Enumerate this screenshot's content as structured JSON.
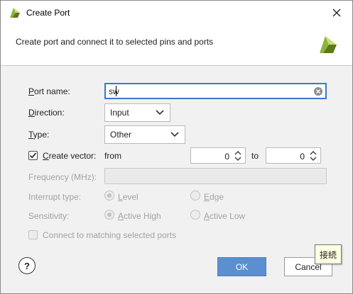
{
  "window": {
    "title": "Create Port",
    "close_icon": "close-icon",
    "logo_icon": "vivado-logo-icon"
  },
  "header": {
    "description": "Create port and connect it to selected pins and ports"
  },
  "form": {
    "port_name": {
      "label_ul": "P",
      "label_rest": "ort name:",
      "value": "sw"
    },
    "direction": {
      "label_ul": "D",
      "label_rest": "irection:",
      "value": "Input"
    },
    "type": {
      "label_ul": "T",
      "label_rest": "ype:",
      "value": "Other"
    },
    "create_vector": {
      "label_ul": "C",
      "label_rest": "reate vector:",
      "checked": true,
      "from_label": "from",
      "from_value": "0",
      "to_label": "to",
      "to_value": "0"
    },
    "frequency": {
      "label": "Frequency (MHz):",
      "value": ""
    },
    "interrupt_type": {
      "label": "Interrupt type:",
      "option_level_ul": "L",
      "option_level_rest": "evel",
      "option_edge_ul": "E",
      "option_edge_rest": "dge",
      "selected": "Level"
    },
    "sensitivity": {
      "label": "Sensitivity:",
      "option_high_ul": "A",
      "option_high_rest": "ctive High",
      "option_low_ul": "A",
      "option_low_rest": "ctive Low",
      "selected": "Active High"
    },
    "connect_matching": {
      "label": "Connect to matching selected ports",
      "checked": false
    }
  },
  "footer": {
    "help_label": "?",
    "ok_label": "OK",
    "cancel_label": "Cancel",
    "tooltip": "接続"
  },
  "colors": {
    "ok_button": "#5b8fd0",
    "focus_border": "#3b78c8",
    "logo_green": "#8cb43c",
    "logo_dark": "#5a7a1e"
  }
}
